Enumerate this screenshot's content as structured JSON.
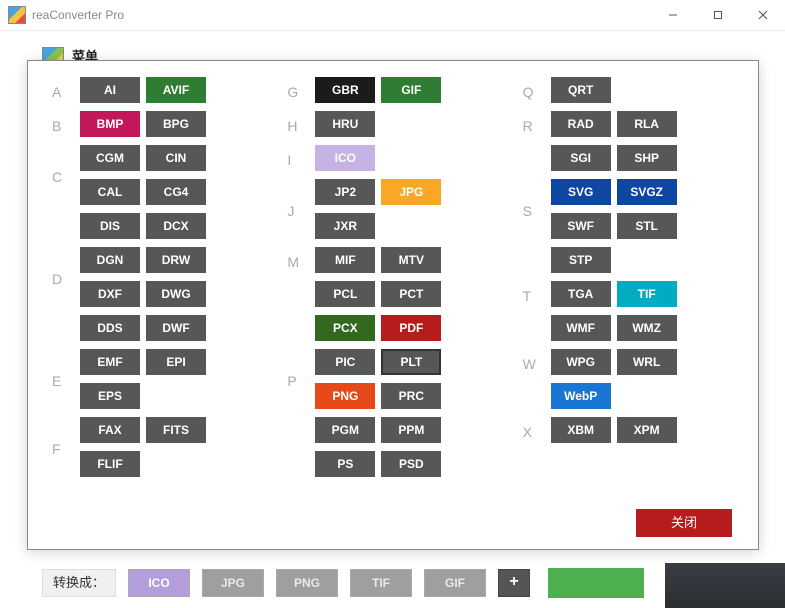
{
  "window": {
    "title": "reaConverter Pro"
  },
  "menu": {
    "label": "菜单"
  },
  "columns": [
    [
      {
        "letter": "A",
        "items": [
          {
            "t": "AI"
          },
          {
            "t": "AVIF",
            "cls": "c-avif"
          }
        ]
      },
      {
        "letter": "B",
        "items": [
          {
            "t": "BMP",
            "cls": "c-bmp"
          },
          {
            "t": "BPG"
          }
        ]
      },
      {
        "letter": "C",
        "items": [
          {
            "t": "CGM"
          },
          {
            "t": "CIN"
          },
          {
            "t": "CAL"
          },
          {
            "t": "CG4"
          }
        ]
      },
      {
        "letter": "D",
        "items": [
          {
            "t": "DIS"
          },
          {
            "t": "DCX"
          },
          {
            "t": "DGN"
          },
          {
            "t": "DRW"
          },
          {
            "t": "DXF"
          },
          {
            "t": "DWG"
          },
          {
            "t": "DDS"
          },
          {
            "t": "DWF"
          }
        ]
      },
      {
        "letter": "E",
        "items": [
          {
            "t": "EMF"
          },
          {
            "t": "EPI"
          },
          {
            "t": "EPS"
          }
        ]
      },
      {
        "letter": "F",
        "items": [
          {
            "t": "FAX"
          },
          {
            "t": "FITS"
          },
          {
            "t": "FLIF"
          }
        ]
      }
    ],
    [
      {
        "letter": "G",
        "items": [
          {
            "t": "GBR",
            "cls": "c-gbr"
          },
          {
            "t": "GIF",
            "cls": "c-gif"
          }
        ]
      },
      {
        "letter": "H",
        "items": [
          {
            "t": "HRU"
          }
        ]
      },
      {
        "letter": "I",
        "items": [
          {
            "t": "ICO",
            "cls": "c-ico"
          }
        ]
      },
      {
        "letter": "J",
        "items": [
          {
            "t": "JP2"
          },
          {
            "t": "JPG",
            "cls": "c-jpg"
          },
          {
            "t": "JXR"
          }
        ]
      },
      {
        "letter": "M",
        "items": [
          {
            "t": "MIF"
          },
          {
            "t": "MTV"
          }
        ]
      },
      {
        "letter": "P",
        "items": [
          {
            "t": "PCL"
          },
          {
            "t": "PCT"
          },
          {
            "t": "PCX",
            "cls": "c-pcx"
          },
          {
            "t": "PDF",
            "cls": "c-pdf"
          },
          {
            "t": "PIC"
          },
          {
            "t": "PLT",
            "cls": "c-plt"
          },
          {
            "t": "PNG",
            "cls": "c-png"
          },
          {
            "t": "PRC"
          },
          {
            "t": "PGM"
          },
          {
            "t": "PPM"
          },
          {
            "t": "PS"
          },
          {
            "t": "PSD"
          }
        ]
      }
    ],
    [
      {
        "letter": "Q",
        "items": [
          {
            "t": "QRT"
          }
        ]
      },
      {
        "letter": "R",
        "items": [
          {
            "t": "RAD"
          },
          {
            "t": "RLA"
          }
        ]
      },
      {
        "letter": "S",
        "items": [
          {
            "t": "SGI"
          },
          {
            "t": "SHP"
          },
          {
            "t": "SVG",
            "cls": "c-svg"
          },
          {
            "t": "SVGZ",
            "cls": "c-svgz"
          },
          {
            "t": "SWF"
          },
          {
            "t": "STL"
          },
          {
            "t": "STP"
          }
        ]
      },
      {
        "letter": "T",
        "items": [
          {
            "t": "TGA"
          },
          {
            "t": "TIF",
            "cls": "c-tif"
          }
        ]
      },
      {
        "letter": "W",
        "items": [
          {
            "t": "WMF"
          },
          {
            "t": "WMZ"
          },
          {
            "t": "WPG"
          },
          {
            "t": "WRL"
          },
          {
            "t": "WebP",
            "cls": "c-webp"
          }
        ]
      },
      {
        "letter": "X",
        "items": [
          {
            "t": "XBM"
          },
          {
            "t": "XPM"
          }
        ]
      }
    ]
  ],
  "close_label": "关闭",
  "bottom": {
    "label": "转换成：",
    "items": [
      {
        "t": "ICO",
        "hl": true
      },
      {
        "t": "JPG"
      },
      {
        "t": "PNG"
      },
      {
        "t": "TIF"
      },
      {
        "t": "GIF"
      }
    ],
    "plus": "+"
  }
}
